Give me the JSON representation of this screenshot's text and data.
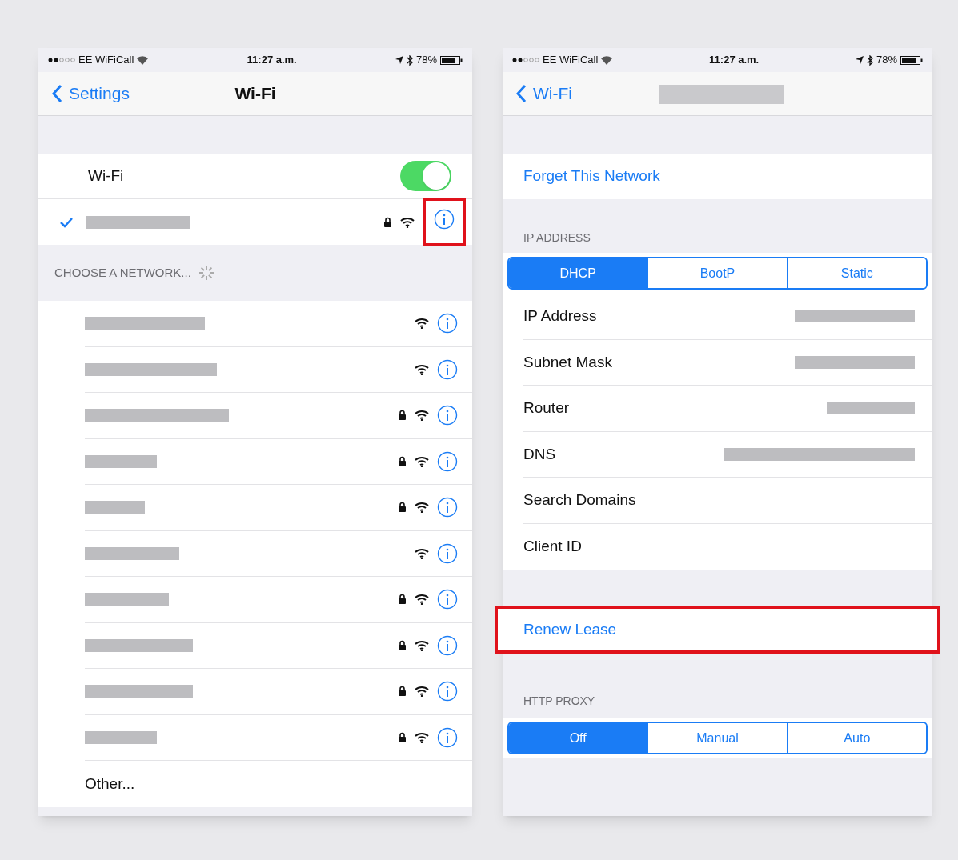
{
  "left_screen": {
    "status_bar": {
      "carrier": "EE WiFiCall",
      "time": "11:27 a.m.",
      "battery": "78%"
    },
    "nav": {
      "back": "Settings",
      "title": "Wi-Fi"
    },
    "wifi_toggle": {
      "label": "Wi-Fi",
      "on": true
    },
    "connected_network": {
      "checked": true,
      "locked": true,
      "info_highlighted": true
    },
    "section_header": "CHOOSE A NETWORK...",
    "networks": [
      {
        "locked": false
      },
      {
        "locked": false
      },
      {
        "locked": true
      },
      {
        "locked": true
      },
      {
        "locked": true
      },
      {
        "locked": false
      },
      {
        "locked": true
      },
      {
        "locked": true
      },
      {
        "locked": true
      },
      {
        "locked": true
      }
    ],
    "other": "Other..."
  },
  "right_screen": {
    "status_bar": {
      "carrier": "EE WiFiCall",
      "time": "11:27 a.m.",
      "battery": "78%"
    },
    "nav": {
      "back": "Wi-Fi"
    },
    "forget": "Forget This Network",
    "ip_header": "IP ADDRESS",
    "ip_modes": [
      {
        "label": "DHCP",
        "selected": true
      },
      {
        "label": "BootP",
        "selected": false
      },
      {
        "label": "Static",
        "selected": false
      }
    ],
    "fields": [
      {
        "label": "IP Address",
        "redacted": true
      },
      {
        "label": "Subnet Mask",
        "redacted": true
      },
      {
        "label": "Router",
        "redacted": true
      },
      {
        "label": "DNS",
        "redacted": true
      },
      {
        "label": "Search Domains",
        "redacted": false
      },
      {
        "label": "Client ID",
        "redacted": false
      }
    ],
    "renew": {
      "label": "Renew Lease",
      "highlighted": true
    },
    "proxy_header": "HTTP PROXY",
    "proxy_modes": [
      {
        "label": "Off",
        "selected": true
      },
      {
        "label": "Manual",
        "selected": false
      },
      {
        "label": "Auto",
        "selected": false
      }
    ]
  }
}
